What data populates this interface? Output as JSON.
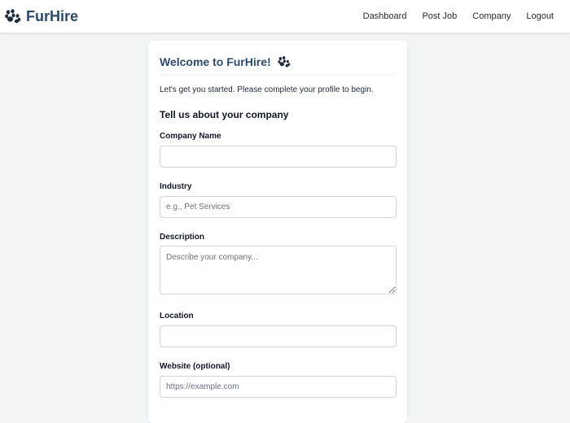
{
  "nav": {
    "brand": "FurHire",
    "links": [
      "Dashboard",
      "Post Job",
      "Company",
      "Logout"
    ]
  },
  "card": {
    "title": "Welcome to FurHire!",
    "intro": "Let's get you started. Please complete your profile to begin.",
    "section_heading": "Tell us about your company"
  },
  "form": {
    "company_name": {
      "label": "Company Name",
      "value": "",
      "placeholder": ""
    },
    "industry": {
      "label": "Industry",
      "value": "",
      "placeholder": "e.g., Pet Services"
    },
    "description": {
      "label": "Description",
      "value": "",
      "placeholder": "Describe your company..."
    },
    "location": {
      "label": "Location",
      "value": "",
      "placeholder": ""
    },
    "website": {
      "label": "Website (optional)",
      "value": "",
      "placeholder": "https://example.com"
    }
  },
  "icons": {
    "brand": "paw-icon",
    "title": "paw-icon"
  },
  "colors": {
    "brand": "#2c4a6b",
    "page_background": "#f3f4f6",
    "card_background": "#ffffff",
    "input_border": "#d1d5db"
  }
}
